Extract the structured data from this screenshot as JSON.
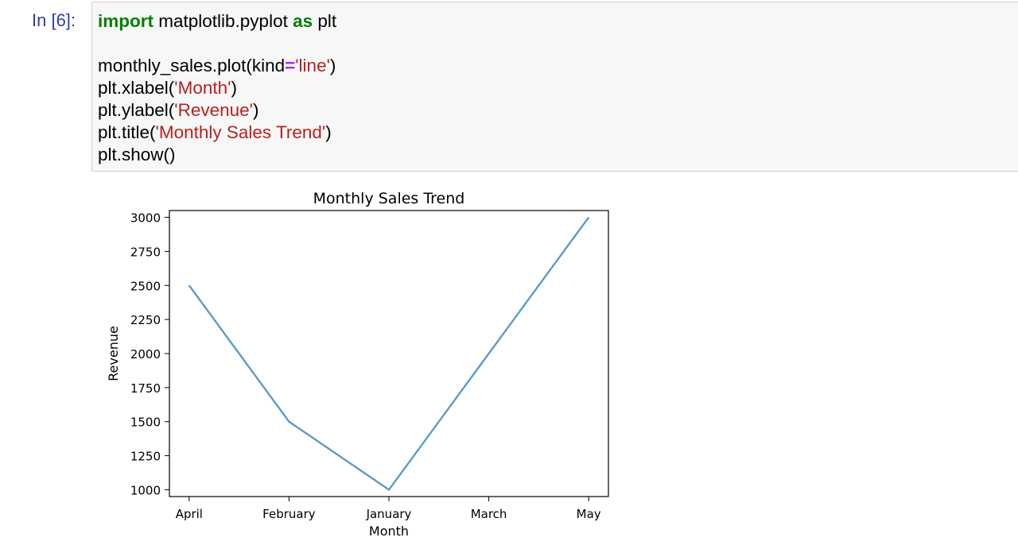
{
  "cell": {
    "prompt": "In [6]:",
    "code": {
      "line1": {
        "kw1": "import",
        "t1": " matplotlib.pyplot ",
        "kw2": "as",
        "t2": " plt"
      },
      "line3": {
        "t1": "monthly_sales.plot(kind",
        "op": "=",
        "s1": "'line'",
        "t2": ")"
      },
      "line4": {
        "t1": "plt.xlabel(",
        "s1": "'Month'",
        "t2": ")"
      },
      "line5": {
        "t1": "plt.ylabel(",
        "s1": "'Revenue'",
        "t2": ")"
      },
      "line6": {
        "t1": "plt.title(",
        "s1": "'Monthly Sales Trend'",
        "t2": ")"
      },
      "line7": {
        "t1": "plt.show()"
      }
    }
  },
  "colors": {
    "keyword": "#008000",
    "operator": "#aa22ff",
    "string": "#ba2121",
    "prompt": "#303f9f",
    "line": "#5b9bc8"
  },
  "chart_data": {
    "type": "line",
    "title": "Monthly Sales Trend",
    "xlabel": "Month",
    "ylabel": "Revenue",
    "categories": [
      "April",
      "February",
      "January",
      "March",
      "May"
    ],
    "values": [
      2500,
      1500,
      1000,
      2000,
      3000
    ],
    "ylim": [
      950,
      3050
    ],
    "yticks": [
      1000,
      1250,
      1500,
      1750,
      2000,
      2250,
      2500,
      2750,
      3000
    ],
    "grid": false
  }
}
